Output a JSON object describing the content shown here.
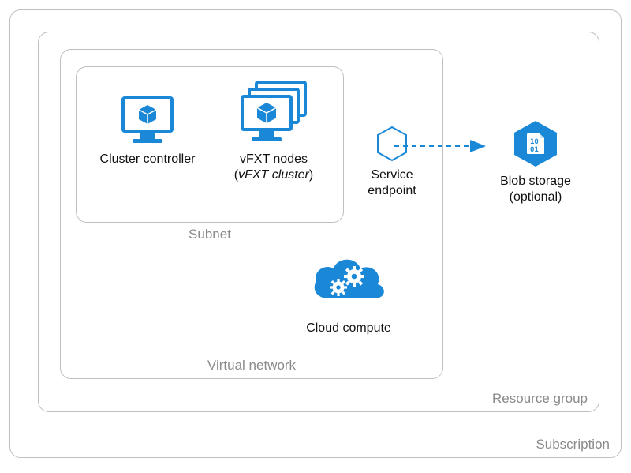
{
  "colors": {
    "azure_blue": "#1B88D7",
    "border_gray": "#bfbfbf",
    "label_gray": "#8a8a8a"
  },
  "containers": {
    "subscription": "Subscription",
    "resource_group": "Resource group",
    "virtual_network": "Virtual network",
    "subnet": "Subnet"
  },
  "nodes": {
    "cluster_controller": {
      "label": "Cluster controller"
    },
    "vfxt_nodes": {
      "label_line1": "vFXT nodes",
      "label_line2_prefix": "(",
      "label_line2_italic": "vFXT cluster",
      "label_line2_suffix": ")"
    },
    "service_endpoint": {
      "label_line1": "Service",
      "label_line2": "endpoint"
    },
    "blob_storage": {
      "label_line1": "Blob storage",
      "label_line2": "(optional)"
    },
    "cloud_compute": {
      "label": "Cloud compute"
    }
  },
  "icons": {
    "cluster_controller": "monitor-cube-icon",
    "vfxt_nodes": "monitor-stack-cube-icon",
    "service_endpoint": "hexagon-outline-icon",
    "blob_storage": "blob-storage-icon",
    "cloud_compute": "cloud-gears-icon"
  }
}
